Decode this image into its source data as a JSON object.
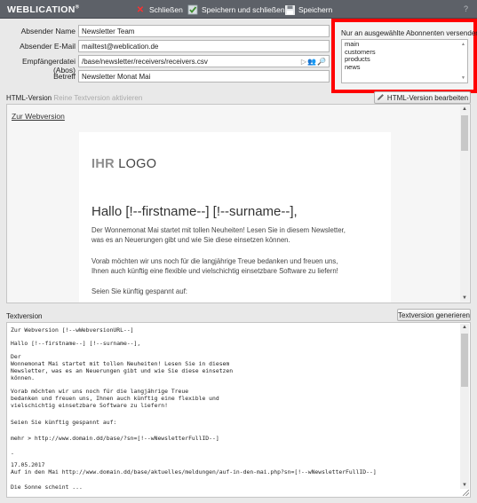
{
  "app": {
    "brand": "WEBLICATION",
    "brand_mark": "®"
  },
  "toolbar": {
    "close_label": "Schließen",
    "save_close_label": "Speichern und schließen",
    "save_label": "Speichern",
    "help_label": "?"
  },
  "form": {
    "sender_name_label": "Absender Name",
    "sender_name_value": "Newsletter Team",
    "sender_email_label": "Absender E-Mail",
    "sender_email_value": "mailtest@weblication.de",
    "recipients_label": "Empfängerdatei (Abos)",
    "recipients_value": "/base/newsletter/receivers/receivers.csv",
    "subject_label": "Betreff",
    "subject_value": "Newsletter Monat Mai"
  },
  "subscribers": {
    "label": "Nur an ausgewählte Abonnenten versenden",
    "items": [
      "main",
      "customers",
      "products",
      "news"
    ]
  },
  "html_section": {
    "label": "HTML-Version",
    "muted_label": "Reine Textversion aktivieren",
    "edit_button": "HTML-Version bearbeiten",
    "webversion_link": "Zur Webversion",
    "logo_strong": "IHR",
    "logo_rest": " LOGO",
    "greeting": "Hallo [!--firstname--] [!--surname--],",
    "p1_line1": "Der Wonnemonat Mai startet mit tollen Neuheiten! Lesen Sie in diesem Newsletter,",
    "p1_line2": "was es an Neuerungen gibt und wie Sie diese einsetzen können.",
    "p2_line1": "Vorab möchten wir uns noch für die langjährige Treue bedanken und freuen uns,",
    "p2_line2": "Ihnen auch künftig eine flexible und vielschichtig einsetzbare Software zu liefern!",
    "p3": "Seien Sie künftig gespannt auf:"
  },
  "text_section": {
    "label": "Textversion",
    "generate_button": "Textversion generieren",
    "lines": [
      "Zur Webversion [!--wWebversionURL--]",
      "Hallo [!--firstname--] [!--surname--],",
      "Der",
      "Wonnemonat Mai startet mit tollen Neuheiten! Lesen Sie in diesem",
      "Newsletter, was es an Neuerungen gibt und wie Sie diese einsetzen",
      "können.",
      "Vorab möchten wir uns noch für die langjährige Treue",
      "bedanken und freuen uns, Ihnen auch künftig eine flexible und",
      "vielschichtig einsetzbare Software zu liefern!",
      "Seien Sie künftig gespannt auf:",
      "mehr > http://www.domain.dd/base/?sn=[!--wNewsletterFullID--]",
      "-",
      "17.05.2017",
      "Auf in den Mai http://www.domain.dd/base/aktuelles/meldungen/auf-in-den-mai.php?sn=[!--wNewsletterFullID--]",
      "Die Sonne scheint ..."
    ]
  },
  "colors": {
    "topbar": "#5d6168",
    "highlight": "#ff0000",
    "close_x": "#ff3030",
    "save_green": "#3f8f2e"
  }
}
